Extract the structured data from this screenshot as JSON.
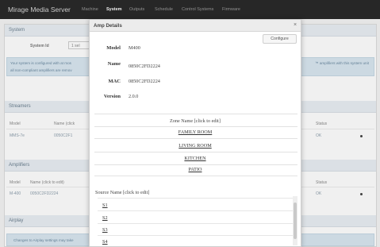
{
  "navbar": {
    "brand": "Mirage Media Server",
    "items": [
      {
        "label": "Machine"
      },
      {
        "label": "System"
      },
      {
        "label": "Outputs"
      },
      {
        "label": "Schedule"
      },
      {
        "label": "Control Systems"
      },
      {
        "label": "Firmware"
      }
    ],
    "active": "System"
  },
  "system": {
    "title": "System",
    "id_label": "System Id",
    "id_value": "1 sel",
    "alert_line1": "Your system is configured with at mos",
    "alert_line1_right": "™ amplifiers with this system unit",
    "alert_line2": "all non-compliant amplifiers are remov"
  },
  "streamers": {
    "title": "Streamers",
    "headers": {
      "model": "Model",
      "name": "Name (click",
      "status": "Status"
    },
    "rows": [
      {
        "model": "MMS-7e",
        "name": "0050C2F1",
        "status": "OK"
      }
    ]
  },
  "amplifiers": {
    "title": "Amplifiers",
    "headers": {
      "model": "Model",
      "name": "Name (click to edit)",
      "status": "Status"
    },
    "rows": [
      {
        "model": "M-400",
        "name": "0050C2FD2224",
        "status": "OK"
      }
    ]
  },
  "airplay": {
    "title": "Airplay",
    "note": "Changes to Airplay settings may take"
  },
  "modal": {
    "title": "Amp Details",
    "close": "×",
    "configure_label": "Configure",
    "details": [
      {
        "key": "Model",
        "value": "M400"
      },
      {
        "key": "Name",
        "value": "0850C2FD2224"
      },
      {
        "key": "MAC",
        "value": "0850C2FD2224"
      },
      {
        "key": "Version",
        "value": "2.0.0"
      }
    ],
    "zone_header": "Zone Name [click to edit]",
    "zones": [
      "FAMILY ROOM",
      "LIVING ROOM",
      "KITCHEN",
      "PATIO"
    ],
    "source_header": "Source Name [click to edit]",
    "sources": [
      "S1",
      "S2",
      "S3",
      "S4"
    ]
  }
}
